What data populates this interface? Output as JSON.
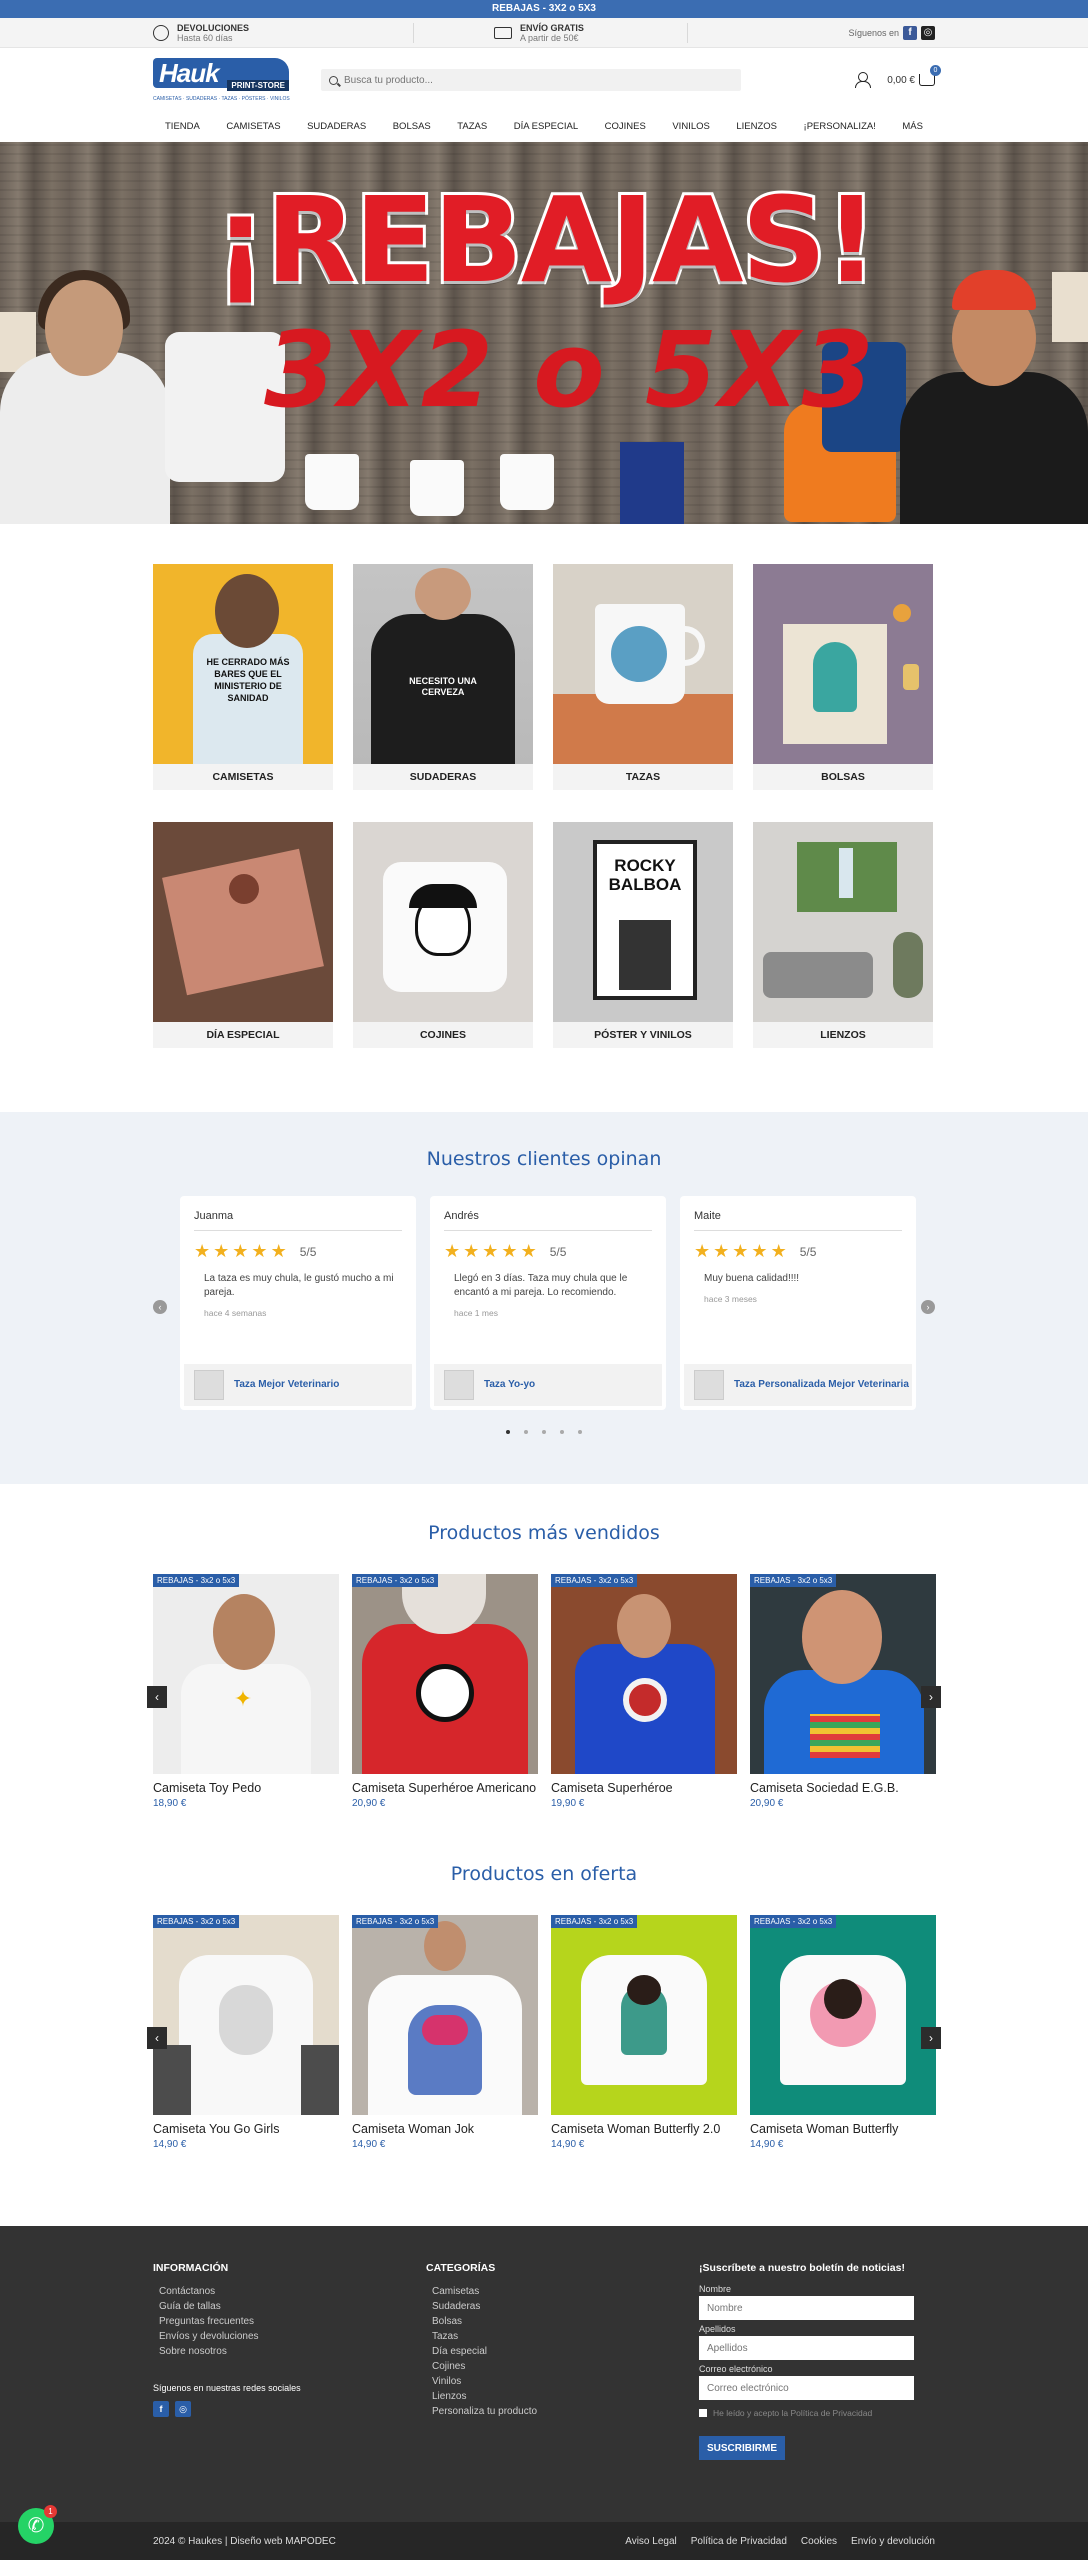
{
  "topbar": {
    "promo": "REBAJAS - 3X2 o 5X3"
  },
  "infobar": {
    "returns_title": "DEVOLUCIONES",
    "returns_sub": "Hasta 60 días",
    "shipping_title": "ENVÍO GRATIS",
    "shipping_sub": "A partir de 50€",
    "follow_label": "Síguenos en",
    "social_icons": [
      "facebook-icon",
      "instagram-icon"
    ]
  },
  "header": {
    "logo_text": "Hauk",
    "logo_sub": "PRINT-STORE",
    "logo_line": "CAMISETAS · SUDADERAS · TAZAS · PÓSTERS · VINILOS",
    "search_placeholder": "Busca tu producto...",
    "cart_total": "0,00 €",
    "cart_count": "0"
  },
  "nav": {
    "items": [
      "Tienda",
      "Camisetas",
      "Sudaderas",
      "Bolsas",
      "Tazas",
      "Día especial",
      "Cojines",
      "Vinilos",
      "Lienzos",
      "¡Personaliza!",
      "Más"
    ]
  },
  "hero": {
    "title": "¡REBAJAS!",
    "subtitle": "3X2 o 5X3"
  },
  "categories": [
    {
      "label": "Camisetas",
      "image_text": "HE CERRADO MÁS BARES QUE EL MINISTERIO DE SANIDAD"
    },
    {
      "label": "Sudaderas",
      "image_text": "NECESITO UNA CERVEZA"
    },
    {
      "label": "Tazas",
      "image_text": ""
    },
    {
      "label": "Bolsas",
      "image_text": ""
    },
    {
      "label": "Día especial",
      "image_text": ""
    },
    {
      "label": "Cojines",
      "image_text": ""
    },
    {
      "label": "Póster y vinilos",
      "image_text": "ROCKY BALBOA"
    },
    {
      "label": "Lienzos",
      "image_text": ""
    }
  ],
  "reviews": {
    "title": "Nuestros clientes opinan",
    "items": [
      {
        "name": "Juanma",
        "score": "5/5",
        "text": "La taza es muy chula, le gustó mucho a mi pareja.",
        "time": "hace 4 semanas",
        "product": "Taza Mejor Veterinario"
      },
      {
        "name": "Andrés",
        "score": "5/5",
        "text": "Llegó en 3 días. Taza muy chula que le encantó a mi pareja. Lo recomiendo.",
        "time": "hace 1 mes",
        "product": "Taza Yo-yo"
      },
      {
        "name": "Maite",
        "score": "5/5",
        "text": "Muy buena calidad!!!!",
        "time": "hace 3 meses",
        "product": "Taza Personalizada Mejor Veterinaria"
      }
    ]
  },
  "best_sellers": {
    "title": "Productos más vendidos",
    "items": [
      {
        "badge": "REBAJAS - 3x2 o 5x3",
        "name": "Camiseta Toy Pedo",
        "price": "18,90 €"
      },
      {
        "badge": "REBAJAS - 3x2 o 5x3",
        "name": "Camiseta Superhéroe Americano",
        "price": "20,90 €"
      },
      {
        "badge": "REBAJAS - 3x2 o 5x3",
        "name": "Camiseta Superhéroe",
        "price": "19,90 €"
      },
      {
        "badge": "REBAJAS - 3x2 o 5x3",
        "name": "Camiseta Sociedad E.G.B.",
        "price": "20,90 €"
      }
    ]
  },
  "offers": {
    "title": "Productos en oferta",
    "items": [
      {
        "badge": "REBAJAS - 3x2 o 5x3",
        "name": "Camiseta You Go Girls",
        "price": "14,90 €"
      },
      {
        "badge": "REBAJAS - 3x2 o 5x3",
        "name": "Camiseta Woman Jok",
        "price": "14,90 €"
      },
      {
        "badge": "REBAJAS - 3x2 o 5x3",
        "name": "Camiseta Woman Butterfly 2.0",
        "price": "14,90 €"
      },
      {
        "badge": "REBAJAS - 3x2 o 5x3",
        "name": "Camiseta Woman Butterfly",
        "price": "14,90 €"
      }
    ]
  },
  "footer": {
    "info_title": "INFORMACIÓN",
    "info_links": [
      "Contáctanos",
      "Guía de tallas",
      "Preguntas frecuentes",
      "Envíos y devoluciones",
      "Sobre nosotros"
    ],
    "social_title": "Síguenos en nuestras redes sociales",
    "cat_title": "CATEGORÍAS",
    "cat_links": [
      "Camisetas",
      "Sudaderas",
      "Bolsas",
      "Tazas",
      "Día especial",
      "Cojines",
      "Vinilos",
      "Lienzos",
      "Personaliza tu producto"
    ],
    "newsletter_title": "¡Suscríbete a nuestro boletín de noticias!",
    "name_label": "Nombre",
    "name_placeholder": "Nombre",
    "surname_label": "Apellidos",
    "surname_placeholder": "Apellidos",
    "email_label": "Correo electrónico",
    "email_placeholder": "Correo electrónico",
    "privacy_text": "He leído y acepto la Política de Privacidad",
    "subscribe_label": "SUSCRIBIRME",
    "copyright": "2024 © Haukes | Diseño web MAPODEC",
    "legal_links": [
      "Aviso Legal",
      "Política de Privacidad",
      "Cookies",
      "Envío y devolución"
    ]
  },
  "whatsapp": {
    "badge": "1"
  },
  "colors": {
    "brand": "#2a5ea8",
    "topbar": "#3b6db2",
    "sale_red": "#e11d26",
    "footer_bg": "#333333"
  }
}
